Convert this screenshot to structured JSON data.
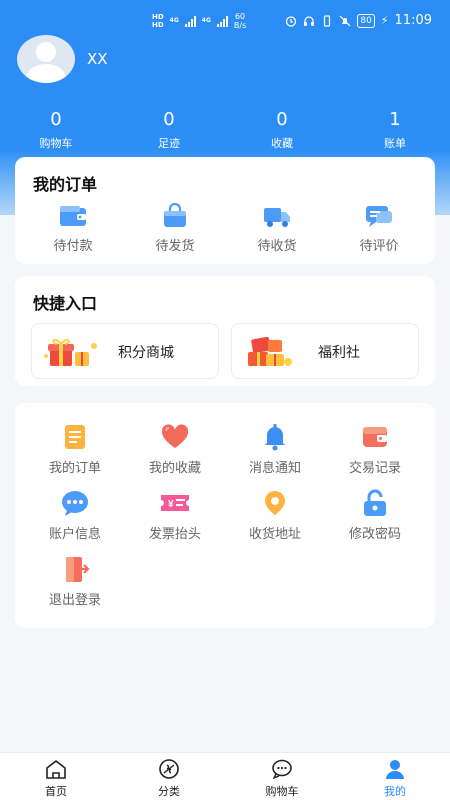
{
  "status_bar": {
    "hd1": "HD",
    "hd2": "HD",
    "net1": "4G",
    "net2": "4G",
    "speed_value": "60",
    "speed_unit": "B/s",
    "battery": "80",
    "time": "11:09"
  },
  "profile": {
    "username": "XX"
  },
  "stats": [
    {
      "value": "0",
      "label": "购物车"
    },
    {
      "value": "0",
      "label": "足迹"
    },
    {
      "value": "0",
      "label": "收藏"
    },
    {
      "value": "1",
      "label": "账单"
    }
  ],
  "orders": {
    "title": "我的订单",
    "items": [
      {
        "label": "待付款",
        "icon": "wallet-icon"
      },
      {
        "label": "待发货",
        "icon": "bag-icon"
      },
      {
        "label": "待收货",
        "icon": "truck-icon"
      },
      {
        "label": "待评价",
        "icon": "chat-icon"
      }
    ]
  },
  "quick": {
    "title": "快捷入口",
    "items": [
      {
        "label": "积分商城",
        "icon": "gift-box-icon"
      },
      {
        "label": "福利社",
        "icon": "gift-pile-icon"
      }
    ]
  },
  "menu": {
    "items": [
      {
        "label": "我的订单",
        "icon": "document-icon"
      },
      {
        "label": "我的收藏",
        "icon": "heart-icon"
      },
      {
        "label": "消息通知",
        "icon": "bell-icon"
      },
      {
        "label": "交易记录",
        "icon": "wallet-icon"
      },
      {
        "label": "账户信息",
        "icon": "chat-bubble-icon"
      },
      {
        "label": "发票抬头",
        "icon": "ticket-icon"
      },
      {
        "label": "收货地址",
        "icon": "location-pin-icon"
      },
      {
        "label": "修改密码",
        "icon": "lock-icon"
      },
      {
        "label": "退出登录",
        "icon": "door-exit-icon"
      }
    ]
  },
  "tabbar": {
    "items": [
      {
        "label": "首页",
        "icon": "home-icon"
      },
      {
        "label": "分类",
        "icon": "category-icon"
      },
      {
        "label": "购物车",
        "icon": "cart-chat-icon"
      },
      {
        "label": "我的",
        "icon": "user-icon"
      }
    ],
    "active": "我的"
  },
  "colors": {
    "primary": "#2a8cf5",
    "background": "#f5f6f9"
  }
}
